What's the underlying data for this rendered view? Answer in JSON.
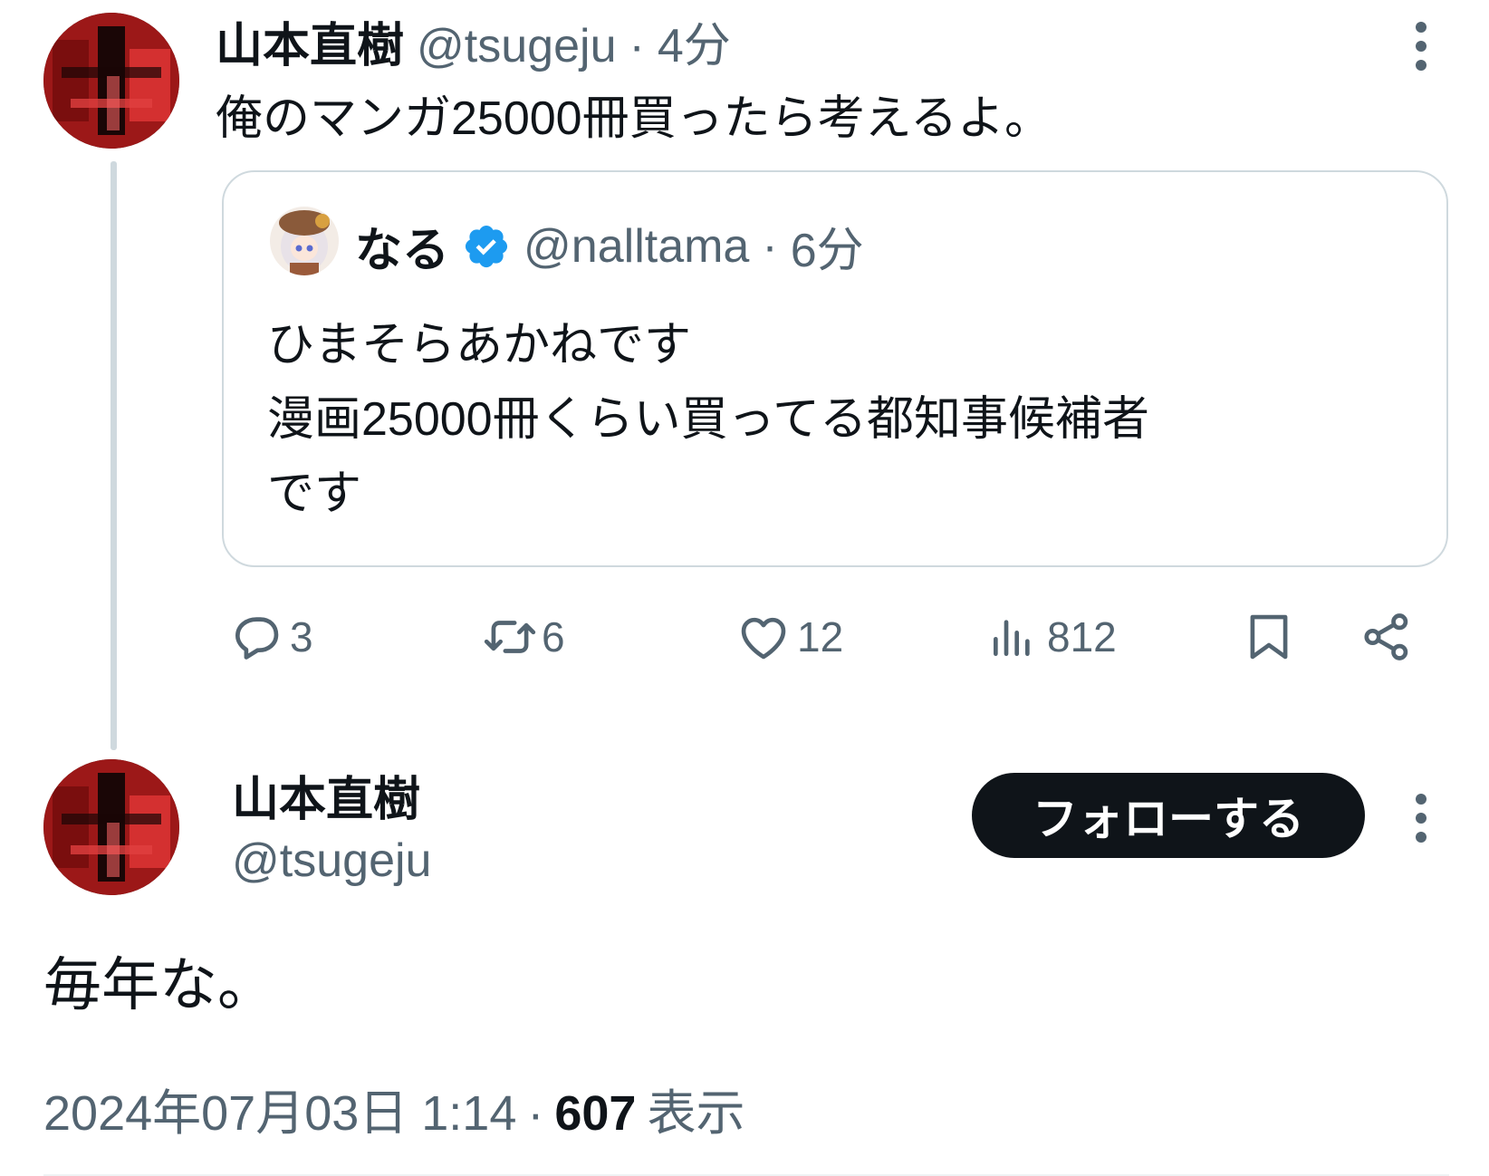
{
  "reply_tweet": {
    "author_name": "山本直樹",
    "author_handle": "@tsugeju",
    "separator": "·",
    "time_ago": "4分",
    "text": "俺のマンガ25000冊買ったら考えるよ。"
  },
  "quoted_tweet": {
    "author_name": "なる",
    "author_handle": "@nalltama",
    "separator": "·",
    "time_ago": "6分",
    "text_lines": [
      "ひまそらあかねです",
      "漫画25000冊くらい買ってる都知事候補者",
      "です"
    ]
  },
  "actions": {
    "replies": "3",
    "retweets": "6",
    "likes": "12",
    "views": "812"
  },
  "main_tweet": {
    "author_name": "山本直樹",
    "author_handle": "@tsugeju",
    "follow_label": "フォローする",
    "text": "毎年な。",
    "timestamp": "2024年07月03日 1:14",
    "separator": "·",
    "view_count": "607",
    "view_label": "表示"
  },
  "colors": {
    "text_primary": "#0f1419",
    "text_secondary": "#536471",
    "verified_blue": "#1d9bf0",
    "border": "#cfd9de",
    "avatar_red": "#b01b1b"
  },
  "icons": [
    "more-icon",
    "verified-badge-icon",
    "reply-icon",
    "retweet-icon",
    "like-icon",
    "views-icon",
    "bookmark-icon",
    "share-icon"
  ]
}
